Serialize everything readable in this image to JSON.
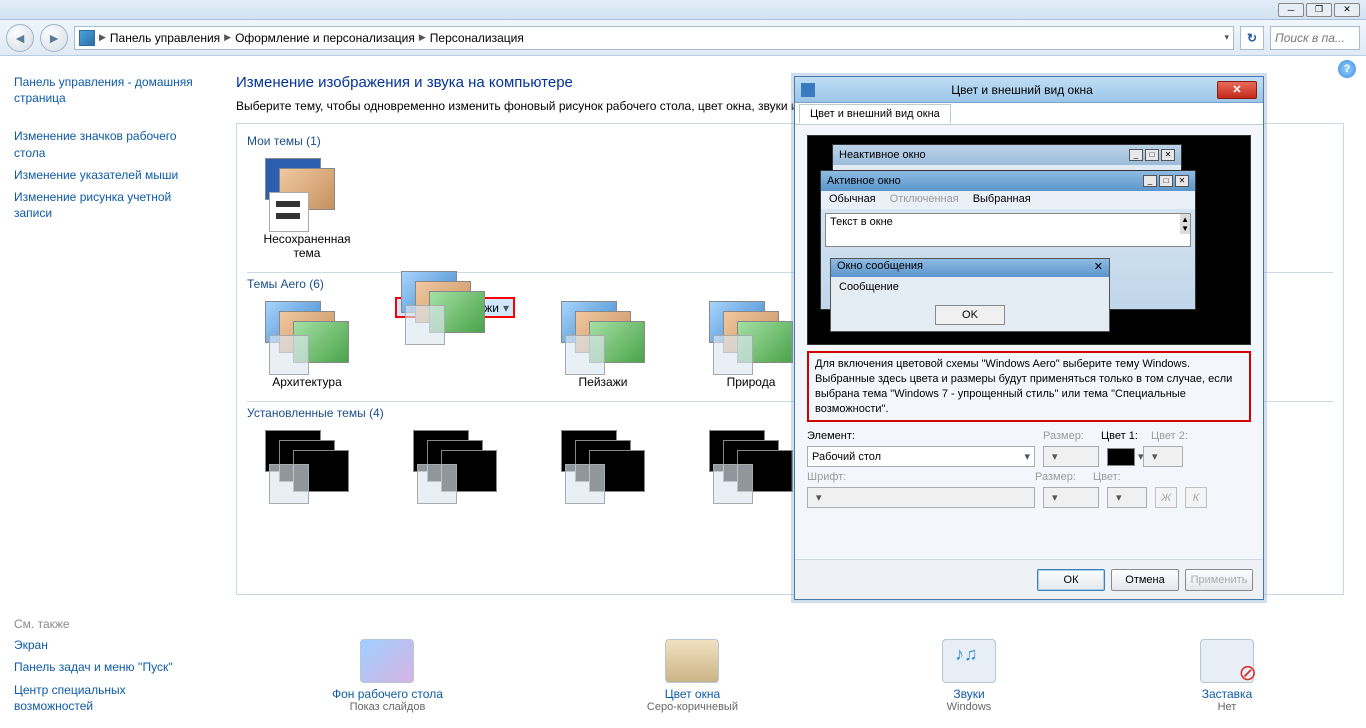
{
  "breadcrumb": {
    "seg1": "Панель управления",
    "seg2": "Оформление и персонализация",
    "seg3": "Персонализация"
  },
  "search_placeholder": "Поиск в па...",
  "sidebar": {
    "home": "Панель управления - домашняя страница",
    "l1": "Изменение значков рабочего стола",
    "l2": "Изменение указателей мыши",
    "l3": "Изменение рисунка учетной записи"
  },
  "seealso": {
    "hdr": "См. также",
    "l1": "Экран",
    "l2": "Панель задач и меню ''Пуск''",
    "l3": "Центр специальных возможностей"
  },
  "main": {
    "hdr": "Изменение изображения и звука на компьютере",
    "sub": "Выберите тему, чтобы одновременно изменить фоновый рисунок рабочего стола, цвет окна, звуки и з",
    "sec1": "Мои темы (1)",
    "t_unsaved": "Несохраненная тема",
    "sec2": "Темы Aero (6)",
    "t_arch": "Архитектура",
    "t_pers": "Персонажи",
    "t_land": "Пейзажи",
    "t_nat": "Природа",
    "sec3": "Установленные темы (4)"
  },
  "bottom": {
    "b1": "Фон рабочего стола",
    "b1s": "Показ слайдов",
    "b2": "Цвет окна",
    "b2s": "Серо-коричневый",
    "b3": "Звуки",
    "b3s": "Windows",
    "b4": "Заставка",
    "b4s": "Нет"
  },
  "dialog": {
    "title": "Цвет и внешний вид окна",
    "tab": "Цвет и внешний вид окна",
    "preview": {
      "inactive": "Неактивное окно",
      "active": "Активное окно",
      "m1": "Обычная",
      "m2": "Отключенная",
      "m3": "Выбранная",
      "text": "Текст в окне",
      "msgtitle": "Окно сообщения",
      "msgbody": "Сообщение",
      "ok": "OK"
    },
    "note": "Для включения цветовой схемы \"Windows Aero\" выберите тему Windows. Выбранные здесь цвета и размеры будут применяться только в том случае, если выбрана тема \"Windows 7 - упрощенный стиль\" или тема \"Специальные возможности\".",
    "lbl_element": "Элемент:",
    "val_element": "Рабочий стол",
    "lbl_size": "Размер:",
    "lbl_c1": "Цвет 1:",
    "lbl_c2": "Цвет 2:",
    "lbl_font": "Шрифт:",
    "lbl_fsize": "Размер:",
    "lbl_fcolor": "Цвет:",
    "style_b": "Ж",
    "style_i": "К",
    "btn_ok": "ОК",
    "btn_cancel": "Отмена",
    "btn_apply": "Применить"
  }
}
